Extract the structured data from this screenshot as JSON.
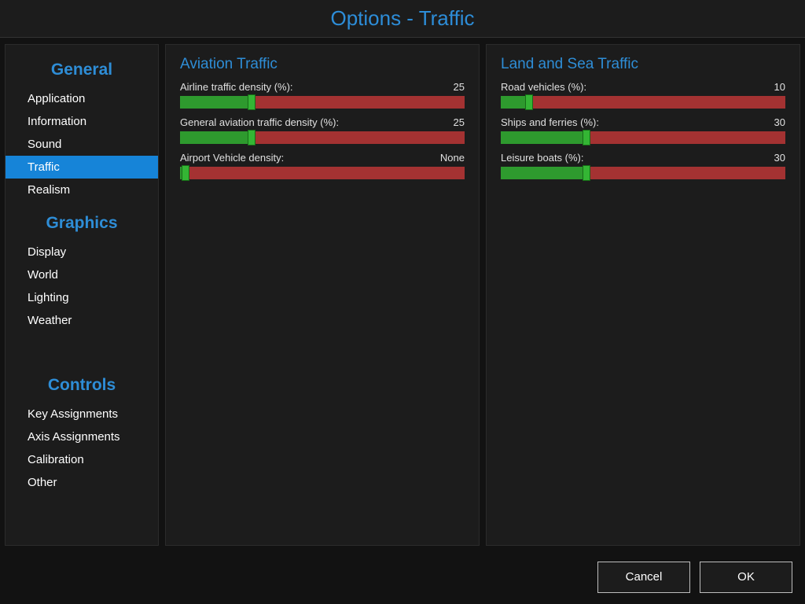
{
  "title": "Options - Traffic",
  "sidebar": {
    "groups": [
      {
        "title": "General",
        "items": [
          {
            "label": "Application",
            "selected": false
          },
          {
            "label": "Information",
            "selected": false
          },
          {
            "label": "Sound",
            "selected": false
          },
          {
            "label": "Traffic",
            "selected": true
          },
          {
            "label": "Realism",
            "selected": false
          }
        ]
      },
      {
        "title": "Graphics",
        "items": [
          {
            "label": "Display",
            "selected": false
          },
          {
            "label": "World",
            "selected": false
          },
          {
            "label": "Lighting",
            "selected": false
          },
          {
            "label": "Weather",
            "selected": false
          }
        ]
      },
      {
        "title": "Controls",
        "items": [
          {
            "label": "Key Assignments",
            "selected": false
          },
          {
            "label": "Axis Assignments",
            "selected": false
          },
          {
            "label": "Calibration",
            "selected": false
          },
          {
            "label": "Other",
            "selected": false
          }
        ]
      }
    ]
  },
  "panels": [
    {
      "title": "Aviation Traffic",
      "sliders": [
        {
          "label": "Airline traffic density (%):",
          "value_text": "25",
          "percent": 25
        },
        {
          "label": "General aviation traffic density (%):",
          "value_text": "25",
          "percent": 25
        },
        {
          "label": "Airport Vehicle density:",
          "value_text": "None",
          "percent": 2
        }
      ]
    },
    {
      "title": "Land and Sea Traffic",
      "sliders": [
        {
          "label": "Road vehicles (%):",
          "value_text": "10",
          "percent": 10
        },
        {
          "label": "Ships and ferries (%):",
          "value_text": "30",
          "percent": 30
        },
        {
          "label": "Leisure boats (%):",
          "value_text": "30",
          "percent": 30
        }
      ]
    }
  ],
  "footer": {
    "cancel": "Cancel",
    "ok": "OK"
  }
}
